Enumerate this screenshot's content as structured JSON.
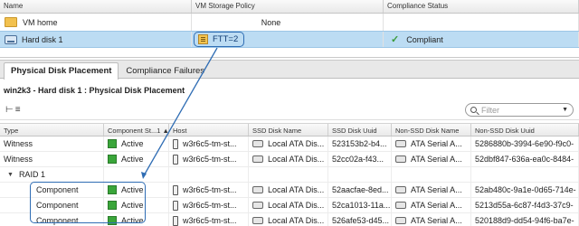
{
  "top_table": {
    "headers": [
      "Name",
      "VM Storage Policy",
      "Compliance Status"
    ],
    "rows": [
      {
        "name": "VM home",
        "policy": "None",
        "compliance": ""
      },
      {
        "name": "Hard disk 1",
        "policy": "FTT=2",
        "compliance": "Compliant"
      }
    ]
  },
  "panel": {
    "tabs": [
      "Physical Disk Placement",
      "Compliance Failures"
    ],
    "title": "win2k3 - Hard disk 1 : Physical Disk Placement",
    "filter_placeholder": "Filter"
  },
  "grid": {
    "headers": [
      "Type",
      "Component St...",
      "Host",
      "SSD Disk Name",
      "SSD Disk Uuid",
      "Non-SSD Disk Name",
      "Non-SSD Disk Uuid"
    ],
    "sort_indicator": "1 ▲",
    "rows": [
      {
        "type": "Witness",
        "state": "Active",
        "host": "w3r6c5-tm-st...",
        "ssd": "Local ATA Dis...",
        "ssd_uuid": "523153b2-b4...",
        "nssd": "ATA Serial A...",
        "nssd_uuid": "5286880b-3994-6e90-f9c0-"
      },
      {
        "type": "Witness",
        "state": "Active",
        "host": "w3r6c5-tm-st...",
        "ssd": "Local ATA Dis...",
        "ssd_uuid": "52cc02a-f43...",
        "nssd": "ATA Serial A...",
        "nssd_uuid": "52dbf847-636a-ea0c-8484-"
      },
      {
        "type": "RAID 1",
        "state": "",
        "host": "",
        "ssd": "",
        "ssd_uuid": "",
        "nssd": "",
        "nssd_uuid": ""
      },
      {
        "type": "Component",
        "state": "Active",
        "host": "w3r6c5-tm-st...",
        "ssd": "Local ATA Dis...",
        "ssd_uuid": "52aacfae-8ed...",
        "nssd": "ATA Serial A...",
        "nssd_uuid": "52ab480c-9a1e-0d65-714e-"
      },
      {
        "type": "Component",
        "state": "Active",
        "host": "w3r6c5-tm-st...",
        "ssd": "Local ATA Dis...",
        "ssd_uuid": "52ca1013-11a...",
        "nssd": "ATA Serial A...",
        "nssd_uuid": "5213d55a-6c87-f4d3-37c9-"
      },
      {
        "type": "Component",
        "state": "Active",
        "host": "w3r6c5-tm-st...",
        "ssd": "Local ATA Dis...",
        "ssd_uuid": "526afe53-d45...",
        "nssd": "ATA Serial A...",
        "nssd_uuid": "520188d9-dd54-94f6-ba7e-"
      }
    ]
  },
  "colors": {
    "accent": "#2f6db4",
    "selected_row": "#bcdcf3",
    "active_green": "#3aa63a"
  }
}
